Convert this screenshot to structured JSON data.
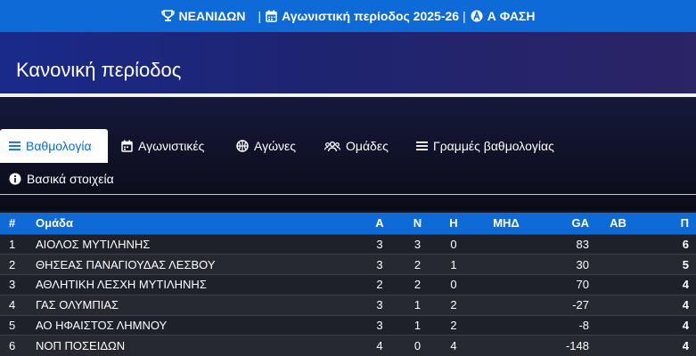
{
  "topbar": {
    "category": "ΝΕΑΝΙΔΩΝ",
    "separator": "|",
    "season": "Αγωνιστική περίοδος 2025-26",
    "separator2": "|",
    "phase": "Α ΦΑΣΗ"
  },
  "header": {
    "title": "Κανονική περίοδος"
  },
  "tabs": [
    {
      "label": "Βαθμολογία",
      "icon": "list-icon"
    },
    {
      "label": "Αγωνιστικές",
      "icon": "calendar-icon"
    },
    {
      "label": "Αγώνες",
      "icon": "basketball-icon"
    },
    {
      "label": "Ομάδες",
      "icon": "users-icon"
    },
    {
      "label": "Γραμμές βαθμολογίας",
      "icon": "list-icon"
    },
    {
      "label": "Βασικά στοιχεία",
      "icon": "info-icon"
    }
  ],
  "standings": {
    "headers": {
      "pos": "#",
      "team": "Ομάδα",
      "played": "Α",
      "won": "Ν",
      "lost": "Η",
      "mid": "ΜΗΔ",
      "ga": "GA",
      "ab": "ΑΒ",
      "pts": "Π"
    },
    "rows": [
      {
        "pos": "1",
        "team": "ΑΙΟΛΟΣ ΜΥΤΙΛΗΝΗΣ",
        "played": "3",
        "won": "3",
        "lost": "0",
        "mid": "",
        "ga": "83",
        "ab": "",
        "pts": "6"
      },
      {
        "pos": "2",
        "team": "ΘΗΣΕΑΣ ΠΑΝΑΓΙΟΥΔΑΣ ΛΕΣΒΟΥ",
        "played": "3",
        "won": "2",
        "lost": "1",
        "mid": "",
        "ga": "30",
        "ab": "",
        "pts": "5"
      },
      {
        "pos": "3",
        "team": "ΑΘΛΗΤΙΚΗ ΛΕΣΧΗ ΜΥΤΙΛΗΝΗΣ",
        "played": "2",
        "won": "2",
        "lost": "0",
        "mid": "",
        "ga": "70",
        "ab": "",
        "pts": "4"
      },
      {
        "pos": "4",
        "team": "ΓΑΣ ΟΛΥΜΠΙΑΣ",
        "played": "3",
        "won": "1",
        "lost": "2",
        "mid": "",
        "ga": "-27",
        "ab": "",
        "pts": "4"
      },
      {
        "pos": "5",
        "team": "ΑΟ ΗΦΑΙΣΤΟΣ ΛΗΜΝΟΥ",
        "played": "3",
        "won": "1",
        "lost": "2",
        "mid": "",
        "ga": "-8",
        "ab": "",
        "pts": "4"
      },
      {
        "pos": "6",
        "team": "ΝΟΠ ΠΟΣΕΙΔΩΝ",
        "played": "4",
        "won": "0",
        "lost": "4",
        "mid": "",
        "ga": "-148",
        "ab": "",
        "pts": "4"
      }
    ]
  }
}
